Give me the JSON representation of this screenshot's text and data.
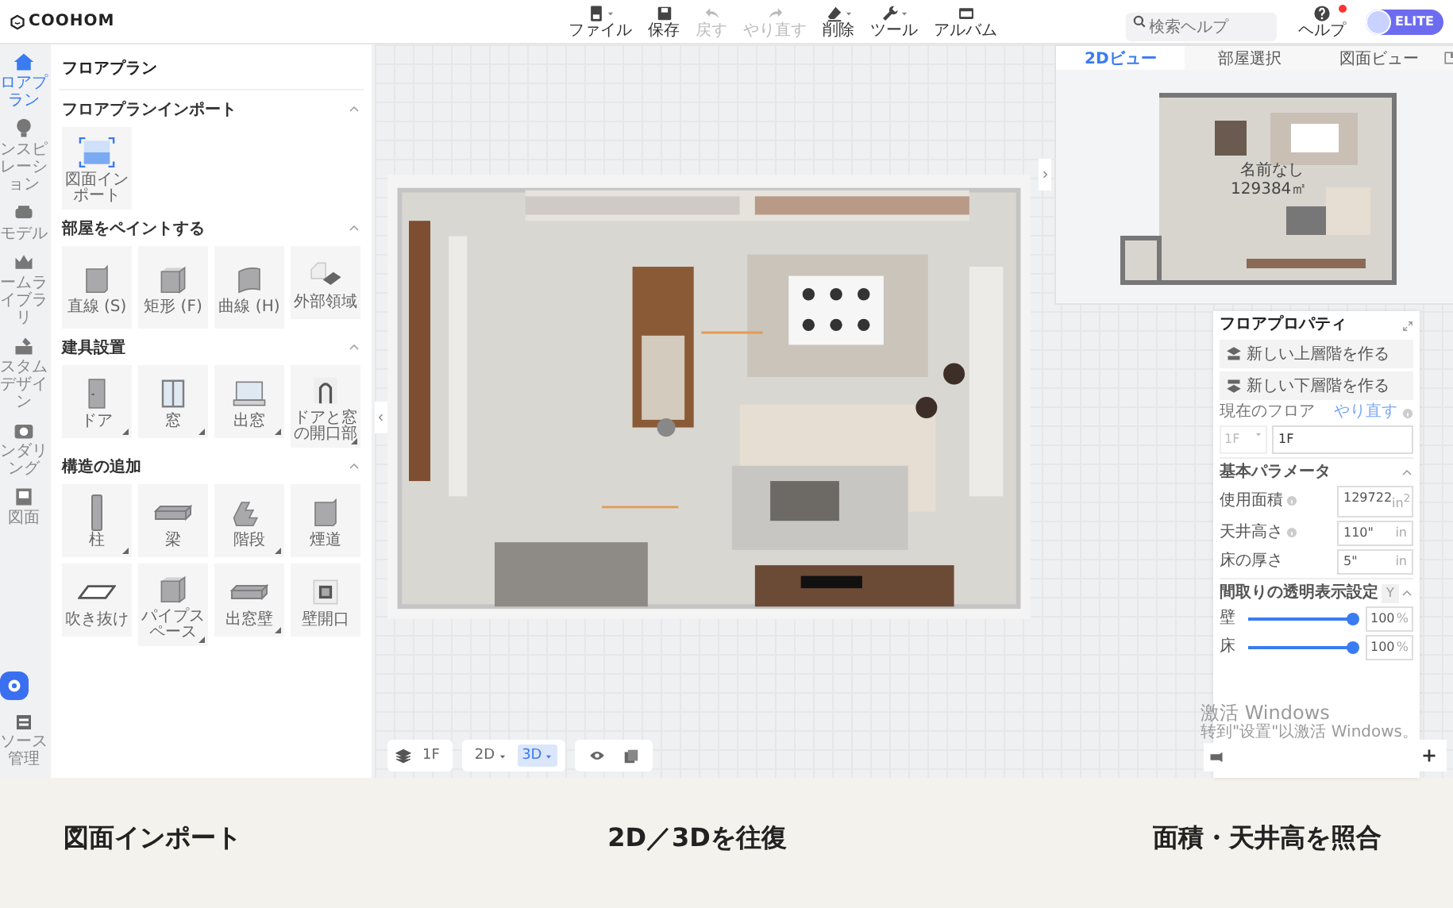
{
  "app_bar": {
    "logo": "COOHOM",
    "tools": [
      {
        "kind": "file",
        "label": "ファイル",
        "caret": true,
        "disabled": false
      },
      {
        "kind": "save",
        "label": "保存",
        "caret": false,
        "disabled": false
      },
      {
        "kind": "undo",
        "label": "戻す",
        "caret": false,
        "disabled": true
      },
      {
        "kind": "redo",
        "label": "やり直す",
        "caret": false,
        "disabled": true
      },
      {
        "kind": "erase",
        "label": "削除",
        "caret": true,
        "disabled": false
      },
      {
        "kind": "wrench",
        "label": "ツール",
        "caret": true,
        "disabled": false
      },
      {
        "kind": "album",
        "label": "アルバム",
        "caret": false,
        "disabled": false
      }
    ],
    "search": {
      "placeholder": "検索ヘルプ"
    },
    "help": {
      "label": "ヘルプ",
      "notification": true
    },
    "plan_badge": "ELITE"
  },
  "sidebar": {
    "items": [
      {
        "kind": "house",
        "label": "ロアプラン",
        "selected": true
      },
      {
        "kind": "bulb",
        "label": "ンスピレーション",
        "selected": false
      },
      {
        "kind": "sofa",
        "label": "モデル",
        "selected": false
      },
      {
        "kind": "crown",
        "label": "ームライブラリ",
        "selected": false
      },
      {
        "kind": "paint",
        "label": "スタムデザイン",
        "selected": false
      },
      {
        "kind": "camera",
        "label": "ンダリング",
        "selected": false
      },
      {
        "kind": "sheet",
        "label": "図面",
        "selected": false
      }
    ],
    "bottom_item": {
      "label": "ソース管理"
    }
  },
  "panel": {
    "title": "フロアプラン",
    "sections": [
      {
        "title": "フロアプランインポート",
        "expanded": true,
        "items": [
          {
            "kind": "import",
            "label": "図面インポート",
            "variants": false
          }
        ]
      },
      {
        "title": "部屋をペイントする",
        "expanded": true,
        "items": [
          {
            "kind": "cube",
            "label": "直線 (S)",
            "variants": false
          },
          {
            "kind": "openbox",
            "label": "矩形 (F)",
            "variants": false
          },
          {
            "kind": "curve",
            "label": "曲線 (H)",
            "variants": false
          },
          {
            "kind": "outer",
            "label": "外部領域",
            "variants": false
          }
        ]
      },
      {
        "title": "建具設置",
        "expanded": true,
        "items": [
          {
            "kind": "door",
            "label": "ドア",
            "variants": true
          },
          {
            "kind": "window",
            "label": "窓",
            "variants": true
          },
          {
            "kind": "baywindow",
            "label": "出窓",
            "variants": true
          },
          {
            "kind": "arch",
            "label": "ドアと窓の開口部",
            "variants": true
          }
        ]
      },
      {
        "title": "構造の追加",
        "expanded": true,
        "items": [
          {
            "kind": "column",
            "label": "柱",
            "variants": true
          },
          {
            "kind": "beam",
            "label": "梁",
            "variants": false
          },
          {
            "kind": "stairs",
            "label": "階段",
            "variants": true
          },
          {
            "kind": "cube",
            "label": "煙道",
            "variants": false
          },
          {
            "kind": "void",
            "label": "吹き抜け",
            "variants": false
          },
          {
            "kind": "openbox",
            "label": "パイプスペース",
            "variants": true
          },
          {
            "kind": "beam",
            "label": "出窓壁",
            "variants": true
          },
          {
            "kind": "frame",
            "label": "壁開口",
            "variants": false
          }
        ]
      }
    ]
  },
  "view_toolbar": {
    "floor": "1F",
    "modes": [
      {
        "label": "2D",
        "selected": false
      },
      {
        "label": "3D",
        "selected": true
      }
    ]
  },
  "mini_view": {
    "tabs": [
      {
        "label": "2Dビュー",
        "selected": true
      },
      {
        "label": "部屋選択",
        "selected": false
      },
      {
        "label": "図面ビュー",
        "selected": false
      }
    ],
    "room_name": "名前なし",
    "room_area": "129384㎡"
  },
  "floor_properties": {
    "title": "フロアプロパティ",
    "buttons": [
      {
        "kind": "up",
        "label": "新しい上層階を作る"
      },
      {
        "kind": "down",
        "label": "新しい下層階を作る"
      }
    ],
    "current_floor": {
      "label": "現在のフロア",
      "link": "やり直す",
      "select": "1F",
      "value": "1F"
    },
    "basic": {
      "title": "基本パラメータ",
      "expanded": true,
      "fields": [
        {
          "label": "使用面積",
          "info": true,
          "value": "129722",
          "unit": "in$^{2}$"
        },
        {
          "label": "天井高さ",
          "info": true,
          "value": "110\"",
          "unit": "in"
        },
        {
          "label": "床の厚さ",
          "info": false,
          "value": "5\"",
          "unit": "in"
        }
      ]
    },
    "transparency": {
      "title": "間取りの透明表示設定",
      "filter": "Y",
      "expanded": true,
      "sliders": [
        {
          "label": "壁",
          "level": 1,
          "value": "100",
          "unit": "%"
        },
        {
          "label": "床",
          "level": 1,
          "value": "100",
          "unit": "%"
        }
      ]
    }
  },
  "system_notice": {
    "title": "激活 Windows",
    "text": "转到\"设置\"以激活 Windows。"
  },
  "captions": [
    "図面インポート",
    "2D／3Dを往復",
    "面積・天井高を照合"
  ]
}
